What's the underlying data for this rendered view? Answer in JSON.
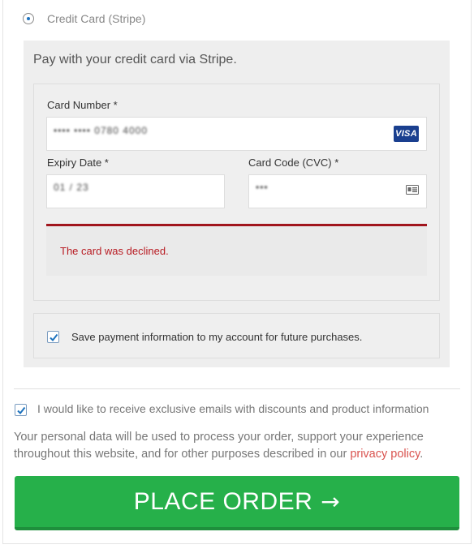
{
  "payment_method": {
    "label": "Credit Card (Stripe)",
    "selected": true
  },
  "stripe": {
    "intro": "Pay with your credit card via Stripe.",
    "card_number": {
      "label": "Card Number *",
      "value": "•••• •••• 0780 4000",
      "brand": "VISA",
      "brand_color": "#1a3f8f"
    },
    "expiry": {
      "label": "Expiry Date *",
      "value": "01 / 23"
    },
    "cvc": {
      "label": "Card Code (CVC) *",
      "value": "•••",
      "icon": "card-code-icon"
    },
    "error": {
      "message": "The card was declined.",
      "color": "#b81c23"
    },
    "save_payment": {
      "label": "Save payment information to my account for future purchases.",
      "checked": true
    }
  },
  "marketing_opt_in": {
    "label": "I would like to receive exclusive emails with discounts and product information",
    "checked": true
  },
  "privacy": {
    "text": "Your personal data will be used to process your order, support your experience throughout this website, and for other purposes described in our",
    "link_text": "privacy policy",
    "suffix": "."
  },
  "place_order": {
    "label": "PLACE ORDER",
    "arrow": "→",
    "color": "#26b04a"
  }
}
